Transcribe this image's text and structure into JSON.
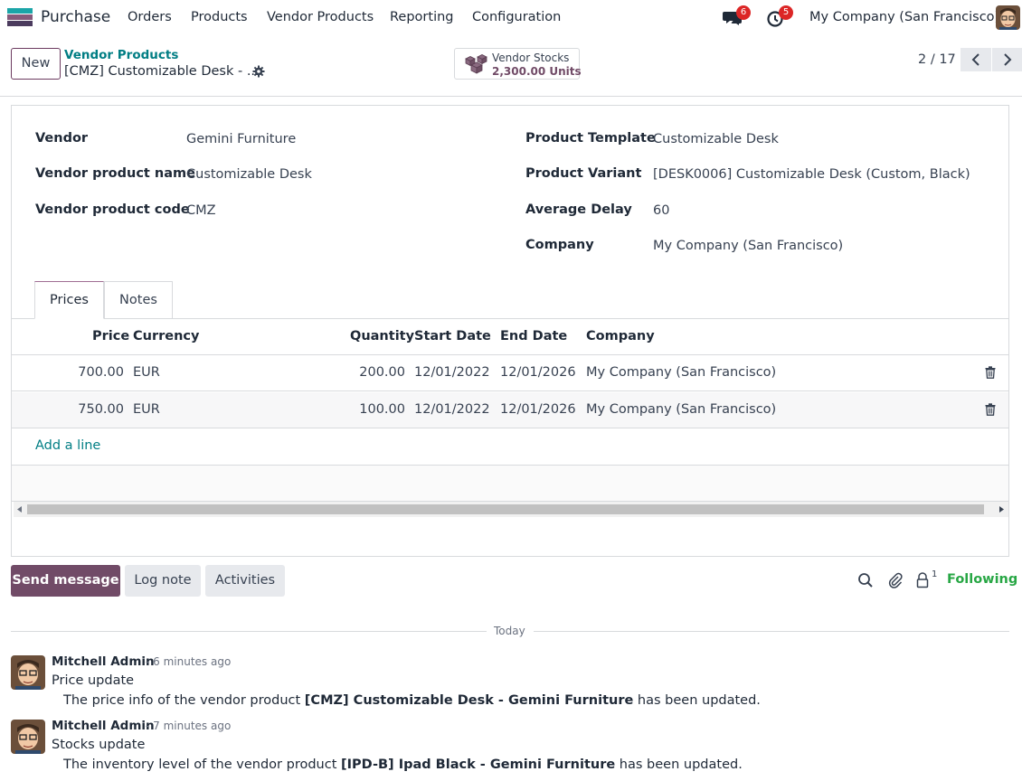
{
  "navbar": {
    "app_name": "Purchase",
    "menu": [
      "Orders",
      "Products",
      "Vendor Products",
      "Reporting",
      "Configuration"
    ],
    "messages_count": "6",
    "activities_count": "5",
    "company": "My Company (San Francisco)"
  },
  "control_panel": {
    "new_label": "New",
    "breadcrumb_parent": "Vendor Products",
    "breadcrumb_current": "[CMZ] Customizable Desk - ...",
    "stat_label": "Vendor Stocks",
    "stat_value": "2,300.00 Units",
    "pager": "2 / 17"
  },
  "form": {
    "left": [
      {
        "label": "Vendor",
        "value": "Gemini Furniture"
      },
      {
        "label": "Vendor product name",
        "value": "Customizable Desk"
      },
      {
        "label": "Vendor product code",
        "value": "CMZ"
      }
    ],
    "right": [
      {
        "label": "Product Template",
        "value": "Customizable Desk"
      },
      {
        "label": "Product Variant",
        "value": "[DESK0006] Customizable Desk (Custom, Black)"
      },
      {
        "label": "Average Delay",
        "value": "60"
      },
      {
        "label": "Company",
        "value": "My Company (San Francisco)"
      }
    ],
    "tabs": [
      "Prices",
      "Notes"
    ],
    "columns": [
      "Price",
      "Currency",
      "Quantity",
      "Start Date",
      "End Date",
      "Company"
    ],
    "rows": [
      {
        "price": "700.00",
        "currency": "EUR",
        "quantity": "200.00",
        "start": "12/01/2022",
        "end": "12/01/2026",
        "company": "My Company (San Francisco)"
      },
      {
        "price": "750.00",
        "currency": "EUR",
        "quantity": "100.00",
        "start": "12/01/2022",
        "end": "12/01/2026",
        "company": "My Company (San Francisco)"
      }
    ],
    "add_line": "Add a line"
  },
  "chatter": {
    "send_message": "Send message",
    "log_note": "Log note",
    "activities": "Activities",
    "followers_count": "1",
    "following": "Following",
    "today": "Today",
    "messages": [
      {
        "author": "Mitchell Admin",
        "time": "- 6 minutes ago",
        "subject": "Price update",
        "body_pre": "The price info of the vendor product ",
        "body_bold": "[CMZ] Customizable Desk - Gemini Furniture",
        "body_post": " has been updated."
      },
      {
        "author": "Mitchell Admin",
        "time": "- 7 minutes ago",
        "subject": "Stocks update",
        "body_pre": "The inventory level of the vendor product ",
        "body_bold": "[IPD-B] Ipad Black - Gemini Furniture",
        "body_post": " has been updated."
      }
    ]
  },
  "colors": {
    "brand": "#714b67",
    "link": "#017e84",
    "following": "#28a745",
    "badge": "#dc2626"
  }
}
